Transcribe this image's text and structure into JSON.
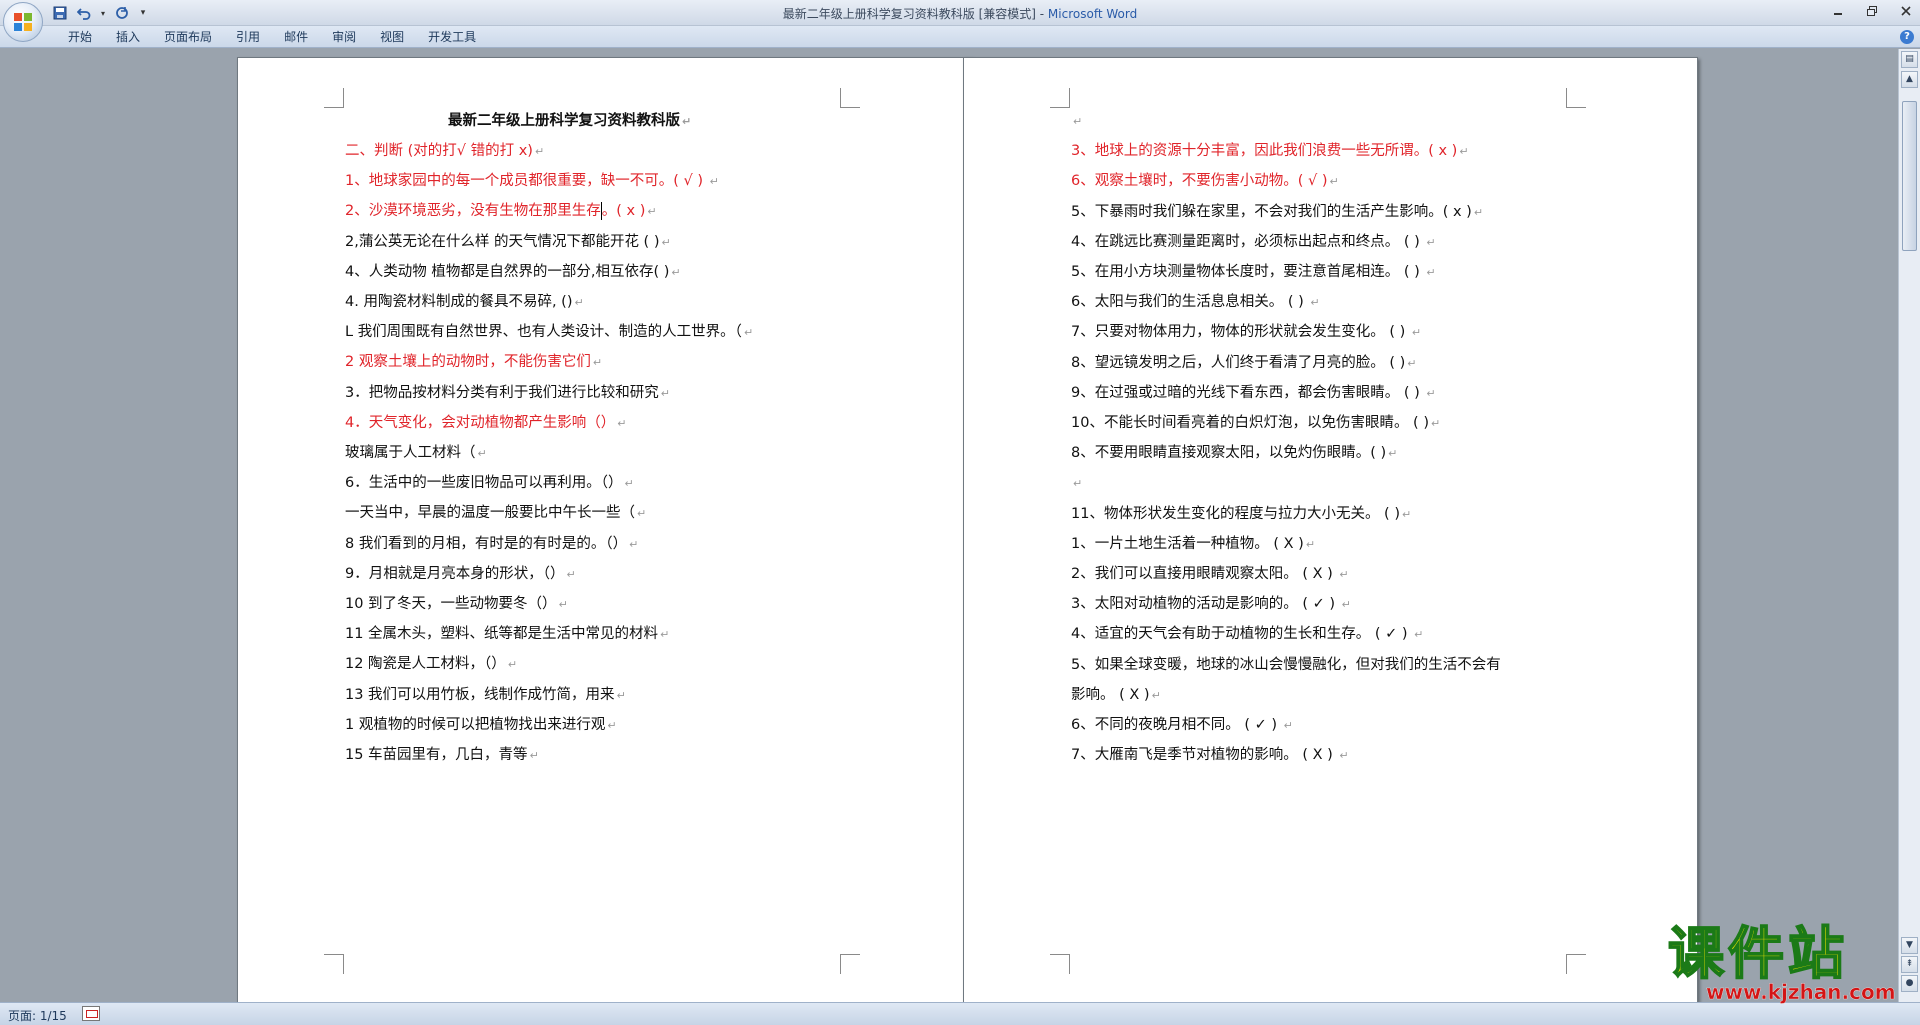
{
  "window": {
    "title_doc": "最新二年级上册科学复习资料教科版 [兼容模式] - ",
    "title_app": "Microsoft Word"
  },
  "ribbon": {
    "tabs": [
      "开始",
      "插入",
      "页面布局",
      "引用",
      "邮件",
      "审阅",
      "视图",
      "开发工具"
    ]
  },
  "page1": {
    "title": "最新二年级上册科学复习资料教科版",
    "lines": [
      {
        "text": "二、判断 (对的打√ 错的打 x)",
        "red": true
      },
      {
        "text": "1、地球家园中的每一个成员都很重要，缺一不可。(   √      )   ",
        "red": true
      },
      {
        "text": "2、沙漠环境恶劣，没有生物在那里生存。(      x        )",
        "red": true,
        "caret_after": 18
      },
      {
        "text": "2,蒲公英无论在什么样 的天气情况下都能开花 ( )",
        "red": false
      },
      {
        "text": "4、人类动物 植物都是自然界的一部分,相互依存( )",
        "red": false
      },
      {
        "text": "4. 用陶瓷材料制成的餐具不易碎, ()",
        "red": false
      },
      {
        "text": "L 我们周围既有自然世界、也有人类设计、制造的人工世界。（",
        "red": false
      },
      {
        "text": "2 观察土壤上的动物时，不能伤害它们",
        "red": true
      },
      {
        "text": "3．把物品按材料分类有利于我们进行比较和研究",
        "red": false
      },
      {
        "text": "4．天气变化，会对动植物都产生影响（）",
        "red": true
      },
      {
        "text": "玻璃属于人工材料（",
        "red": false
      },
      {
        "text": "6．生活中的一些废旧物品可以再利用。（）",
        "red": false
      },
      {
        "text": "一天当中，早晨的温度一般要比中午长一些（",
        "red": false
      },
      {
        "text": "8 我们看到的月相，有时是的有时是的。（）",
        "red": false
      },
      {
        "text": "9．月相就是月亮本身的形状，（）",
        "red": false
      },
      {
        "text": "10 到了冬天，一些动物要冬（）",
        "red": false
      },
      {
        "text": "11 全属木头，塑料、纸等都是生活中常见的材料",
        "red": false
      },
      {
        "text": "12 陶瓷是人工材料，（）",
        "red": false
      },
      {
        "text": "13 我们可以用竹板，线制作成竹简，用来",
        "red": false
      },
      {
        "text": "1 观植物的时候可以把植物找出来进行观",
        "red": false
      },
      {
        "text": "15 车苗园里有，几白，青等",
        "red": false
      }
    ]
  },
  "page2": {
    "lines": [
      {
        "text": "",
        "red": false
      },
      {
        "text": "3、地球上的资源十分丰富，因此我们浪费一些无所谓。(      x       )",
        "red": true
      },
      {
        "text": "6、观察土壤时，不要伤害小动物。(   √          )",
        "red": true
      },
      {
        "text": "5、下暴雨时我们躲在家里，不会对我们的生活产生影响。(    x       )",
        "red": false
      },
      {
        "text": "4、在跳远比赛测量距离时，必须标出起点和终点。       (      )  ",
        "red": false
      },
      {
        "text": "5、在用小方块测量物体长度时，要注意首尾相连。       (      )  ",
        "red": false
      },
      {
        "text": "6、太阳与我们的生活息息相关。                      (         )    ",
        "red": false
      },
      {
        "text": "7、只要对物体用力，物体的形状就会发生变化。        (         )    ",
        "red": false
      },
      {
        "text": "8、望远镜发明之后，人们终于看清了月亮的脸。        (         )",
        "red": false
      },
      {
        "text": "9、在过强或过暗的光线下看东西，都会伤害眼睛。      (         )    ",
        "red": false
      },
      {
        "text": "10、不能长时间看亮着的白炽灯泡，以免伤害眼睛。     (         )",
        "red": false
      },
      {
        "text": "   8、不要用眼睛直接观察太阳，以免灼伤眼睛。(             )",
        "red": false
      },
      {
        "text": "",
        "red": false
      },
      {
        "text": "11、物体形状发生变化的程度与拉力大小无关。         (         )",
        "red": false
      },
      {
        "text": "1、一片土地生活着一种植物。                           (   X   )",
        "red": false
      },
      {
        "text": "2、我们可以直接用眼睛观察太阳。                       (   X   )  ",
        "red": false
      },
      {
        "text": "3、太阳对动植物的活动是影响的。                       ( ✓   )   ",
        "red": false
      },
      {
        "text": "4、适宜的天气会有助于动植物的生长和生存。             ( ✓   )   ",
        "red": false
      },
      {
        "text": "5、如果全球变暖，地球的冰山会慢慢融化，但对我们的生活不会有",
        "red": false,
        "no_mark": true
      },
      {
        "text": "影响。                                              (   X   )",
        "red": false
      },
      {
        "text": "6、不同的夜晚月相不同。                               ( ✓  )    ",
        "red": false
      },
      {
        "text": "7、大雁南飞是季节对植物的影响。                       (  X  )  ",
        "red": false
      }
    ]
  },
  "statusbar": {
    "page": "页面: 1/15"
  },
  "watermark": {
    "brand": "课件站",
    "url": "www.kjzhan.com"
  }
}
